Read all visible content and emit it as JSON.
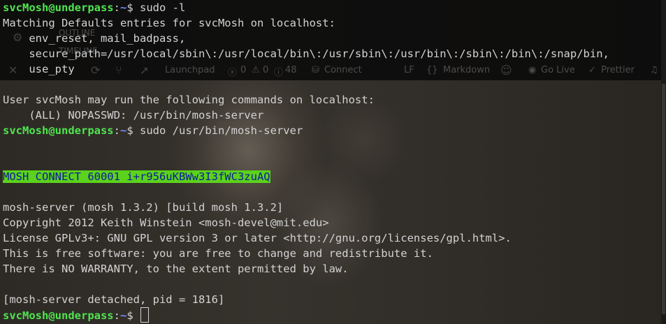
{
  "prompt": {
    "user_host": "svcMosh@underpass",
    "sep": ":",
    "path": "~",
    "sym": "$ "
  },
  "lines": [
    {
      "type": "prompt",
      "cmd": "sudo -l"
    },
    {
      "type": "out",
      "text": "Matching Defaults entries for svcMosh on localhost:"
    },
    {
      "type": "out",
      "text": "    env_reset, mail_badpass,"
    },
    {
      "type": "out",
      "text": "    secure_path=/usr/local/sbin\\:/usr/local/bin\\:/usr/sbin\\:/usr/bin\\:/sbin\\:/bin\\:/snap/bin,"
    },
    {
      "type": "out",
      "text": "    use_pty"
    },
    {
      "type": "blank"
    },
    {
      "type": "out",
      "text": "User svcMosh may run the following commands on localhost:"
    },
    {
      "type": "out",
      "text": "    (ALL) NOPASSWD: /usr/bin/mosh-server"
    },
    {
      "type": "prompt",
      "cmd": "sudo /usr/bin/mosh-server"
    },
    {
      "type": "blank"
    },
    {
      "type": "blank"
    },
    {
      "type": "hl",
      "text": "MOSH CONNECT 60001 i+r956uKBWw3I3fWC3zuAQ"
    },
    {
      "type": "blank"
    },
    {
      "type": "out",
      "text": "mosh-server (mosh 1.3.2) [build mosh 1.3.2]"
    },
    {
      "type": "out",
      "text": "Copyright 2012 Keith Winstein <mosh-devel@mit.edu>"
    },
    {
      "type": "out",
      "text": "License GPLv3+: GNU GPL version 3 or later <http://gnu.org/licenses/gpl.html>."
    },
    {
      "type": "out",
      "text": "This is free software: you are free to change and redistribute it."
    },
    {
      "type": "out",
      "text": "There is NO WARRANTY, to the extent permitted by law."
    },
    {
      "type": "blank"
    },
    {
      "type": "out",
      "text": "[mosh-server detached, pid = 1816]"
    },
    {
      "type": "prompt",
      "cmd": "",
      "cursor": true
    }
  ],
  "ghost": {
    "outline": "OUTLINE",
    "timeline": "TIMELINE",
    "launchpad": "Launchpad",
    "errors": "0",
    "warnings": "0",
    "infos": "48",
    "connect": "Connect",
    "eol": "LF",
    "language": "Markdown",
    "golive": "Go Live",
    "prettier": "Prettier"
  }
}
